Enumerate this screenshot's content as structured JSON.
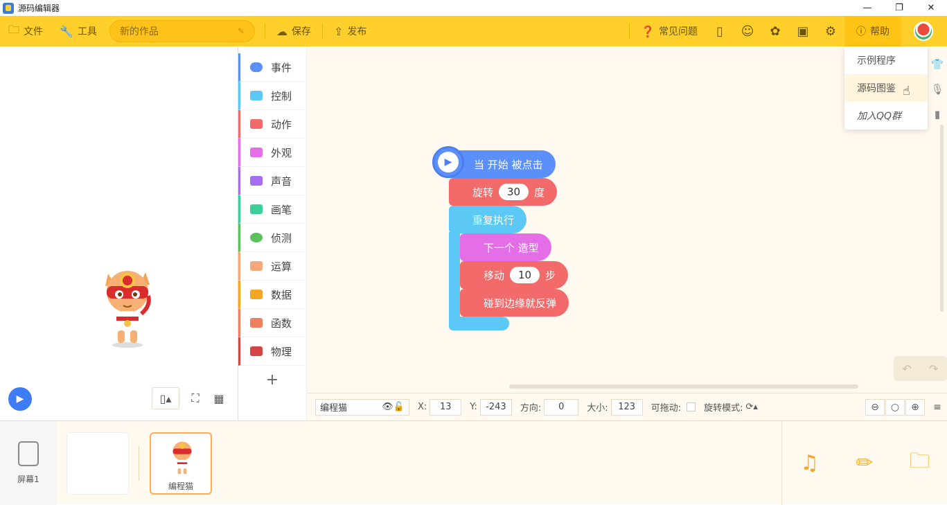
{
  "window": {
    "title": "源码编辑器",
    "min": "—",
    "restore": "❐",
    "close": "✕"
  },
  "toolbar": {
    "file": "文件",
    "tools": "工具",
    "project_name": "新的作品",
    "save": "保存",
    "publish": "发布",
    "faq": "常见问题",
    "help": "帮助"
  },
  "help_menu": {
    "items": [
      "示例程序",
      "源码图鉴",
      "加入QQ群"
    ]
  },
  "categories": [
    {
      "label": "事件",
      "color": "#5b8ff9"
    },
    {
      "label": "控制",
      "color": "#5bc8f5"
    },
    {
      "label": "动作",
      "color": "#f36a6a"
    },
    {
      "label": "外观",
      "color": "#e36ee8"
    },
    {
      "label": "声音",
      "color": "#a66ef0"
    },
    {
      "label": "画笔",
      "color": "#3ccf9a"
    },
    {
      "label": "侦测",
      "color": "#5cc15c"
    },
    {
      "label": "运算",
      "color": "#f7a87a"
    },
    {
      "label": "数据",
      "color": "#f5a623"
    },
    {
      "label": "函数",
      "color": "#f07f5f"
    },
    {
      "label": "物理",
      "color": "#d64545"
    }
  ],
  "add_category": "+",
  "blocks": {
    "when_start": "当 开始 被点击",
    "rotate_prefix": "旋转",
    "rotate_value": "30",
    "rotate_suffix": "度",
    "repeat": "重复执行",
    "next_costume": "下一个 造型",
    "move_prefix": "移动",
    "move_value": "10",
    "move_suffix": "步",
    "bounce": "碰到边缘就反弹"
  },
  "props": {
    "sprite_name": "编程猫",
    "x_label": "X:",
    "x": "13",
    "y_label": "Y:",
    "y": "-243",
    "dir_label": "方向:",
    "dir": "0",
    "size_label": "大小:",
    "size": "123",
    "draggable_label": "可拖动:",
    "rotate_mode_label": "旋转模式:"
  },
  "bottom": {
    "screen_label": "屏幕1",
    "sprite_label": "编程猫"
  }
}
